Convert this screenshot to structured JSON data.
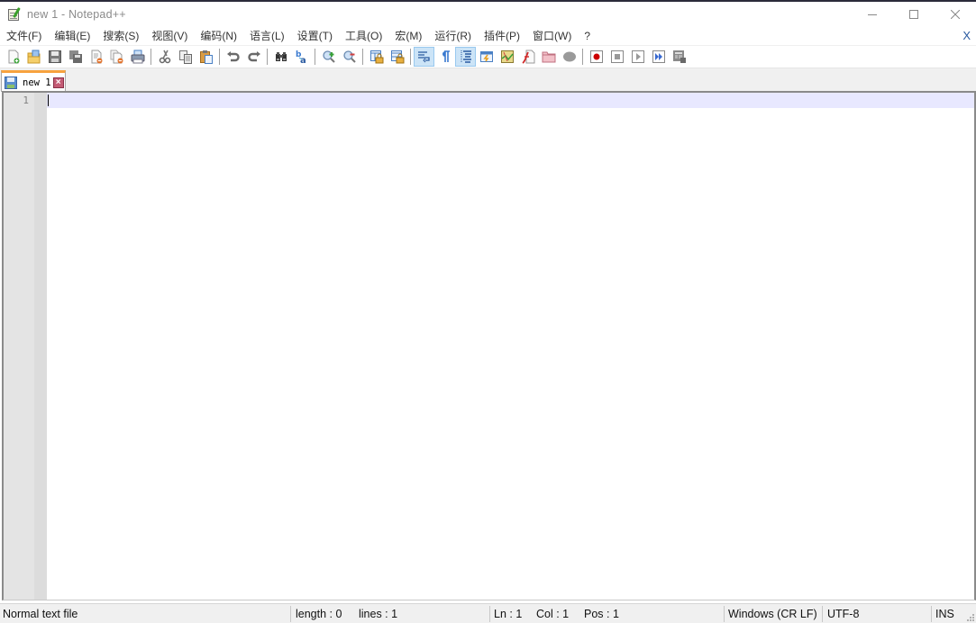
{
  "window": {
    "title": "new 1 - Notepad++",
    "controls": [
      "minimize",
      "maximize",
      "close"
    ]
  },
  "menubar": {
    "items": [
      {
        "label": "文件(F)"
      },
      {
        "label": "编辑(E)"
      },
      {
        "label": "搜索(S)"
      },
      {
        "label": "视图(V)"
      },
      {
        "label": "编码(N)"
      },
      {
        "label": "语言(L)"
      },
      {
        "label": "设置(T)"
      },
      {
        "label": "工具(O)"
      },
      {
        "label": "宏(M)"
      },
      {
        "label": "运行(R)"
      },
      {
        "label": "插件(P)"
      },
      {
        "label": "窗口(W)"
      },
      {
        "label": "?"
      }
    ],
    "close_doc_label": "X"
  },
  "toolbar": {
    "buttons": [
      {
        "name": "new-file",
        "icon": "new-file-icon"
      },
      {
        "name": "open-file",
        "icon": "open-folder-icon"
      },
      {
        "name": "save",
        "icon": "save-icon"
      },
      {
        "name": "save-all",
        "icon": "save-all-icon"
      },
      {
        "name": "close",
        "icon": "close-file-icon"
      },
      {
        "name": "close-all",
        "icon": "close-all-icon"
      },
      {
        "name": "print",
        "icon": "print-icon"
      },
      {
        "name": "cut",
        "icon": "cut-icon"
      },
      {
        "name": "copy",
        "icon": "copy-icon"
      },
      {
        "name": "paste",
        "icon": "paste-icon"
      },
      {
        "name": "undo",
        "icon": "undo-icon"
      },
      {
        "name": "redo",
        "icon": "redo-icon"
      },
      {
        "name": "find",
        "icon": "binoculars-icon"
      },
      {
        "name": "replace",
        "icon": "replace-icon"
      },
      {
        "name": "zoom-in",
        "icon": "zoom-in-icon"
      },
      {
        "name": "zoom-out",
        "icon": "zoom-out-icon"
      },
      {
        "name": "sync-vertical",
        "icon": "sync-vertical-scroll-icon"
      },
      {
        "name": "sync-horizontal",
        "icon": "sync-horizontal-scroll-icon"
      },
      {
        "name": "word-wrap",
        "icon": "word-wrap-icon",
        "active": true
      },
      {
        "name": "show-all-chars",
        "icon": "pilcrow-icon"
      },
      {
        "name": "indent-guide",
        "icon": "indent-guide-icon",
        "active": true
      },
      {
        "name": "udl",
        "icon": "user-defined-language-icon"
      },
      {
        "name": "doc-map",
        "icon": "document-map-icon"
      },
      {
        "name": "function-list",
        "icon": "function-list-icon"
      },
      {
        "name": "folder-as-workspace",
        "icon": "folder-workspace-icon"
      },
      {
        "name": "monitoring",
        "icon": "monitoring-icon"
      },
      {
        "name": "macro-record",
        "icon": "record-icon"
      },
      {
        "name": "macro-stop",
        "icon": "stop-icon"
      },
      {
        "name": "macro-play",
        "icon": "play-icon"
      },
      {
        "name": "macro-run-multiple",
        "icon": "fast-forward-icon"
      },
      {
        "name": "macro-save",
        "icon": "save-macro-icon"
      }
    ]
  },
  "tabs": [
    {
      "label": "new 1",
      "active": true
    }
  ],
  "editor": {
    "line_numbers": [
      "1"
    ],
    "content": ""
  },
  "statusbar": {
    "file_type": "Normal text file",
    "length": "length : 0",
    "lines": "lines : 1",
    "ln": "Ln : 1",
    "col": "Col : 1",
    "pos": "Pos : 1",
    "eol": "Windows (CR LF)",
    "encoding": "UTF-8",
    "mode": "INS"
  },
  "colors": {
    "active_tab_accent": "#f7a23e",
    "current_line": "#e8e8ff",
    "gutter": "#e4e4e4",
    "toolbar_active": "#cce4f7"
  }
}
